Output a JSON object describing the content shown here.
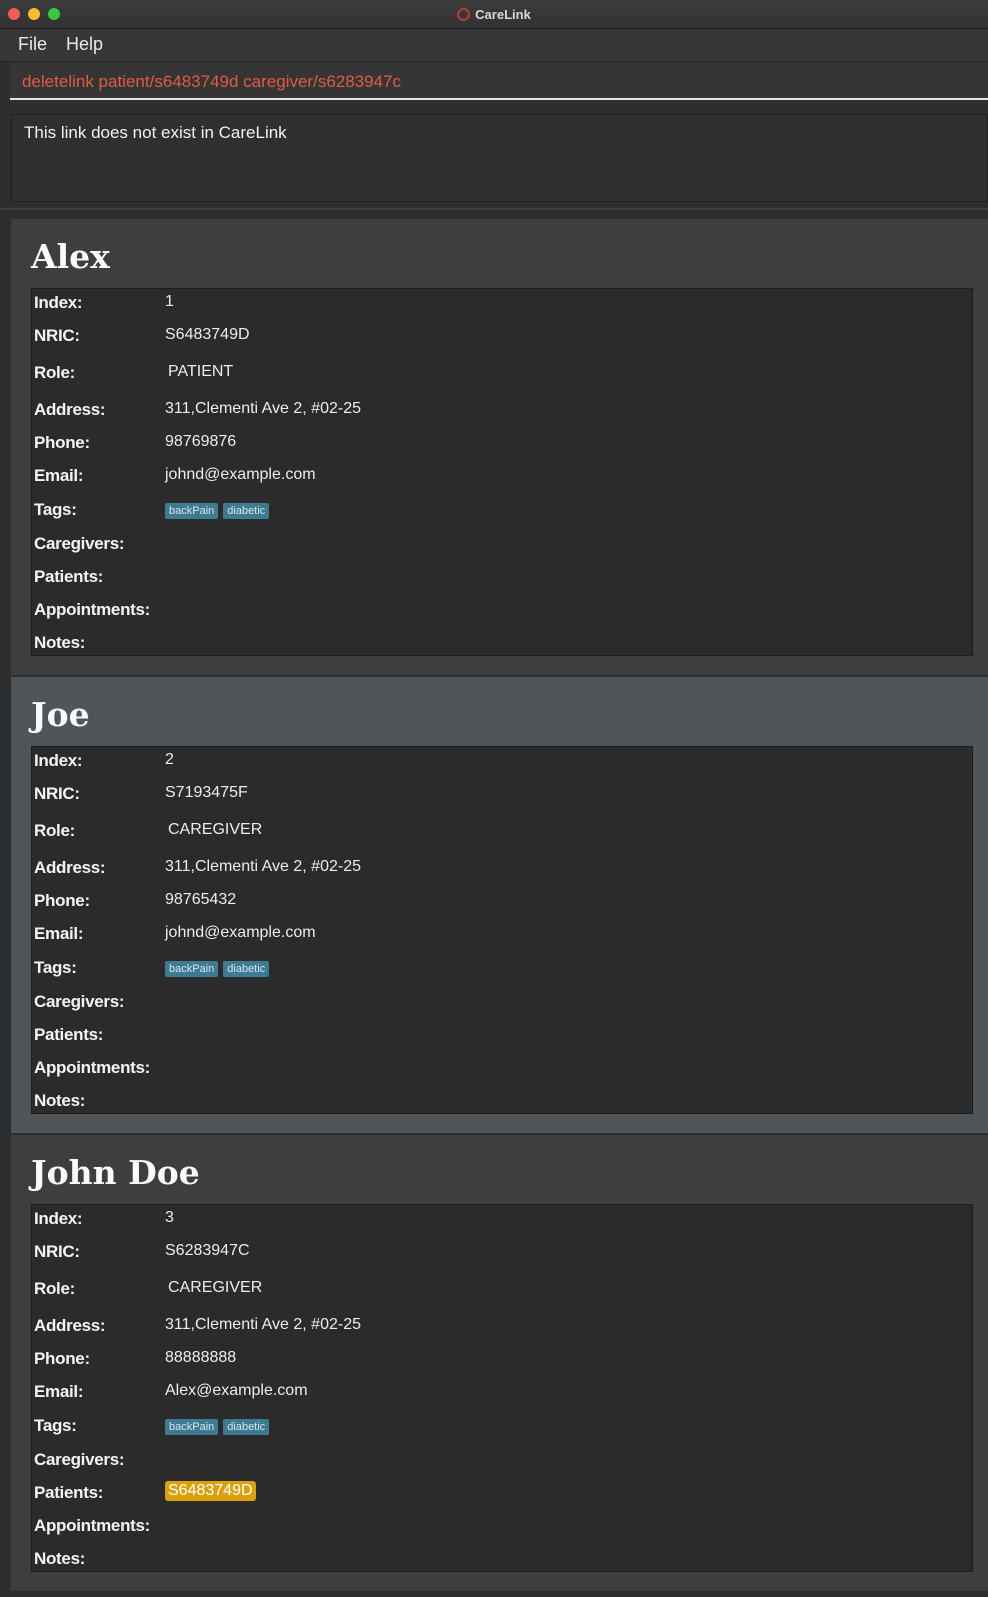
{
  "window": {
    "title": "CareLink"
  },
  "menu": {
    "file": "File",
    "help": "Help"
  },
  "command": {
    "value": "deletelink patient/s6483749d caregiver/s6283947c"
  },
  "result": {
    "message": "This link does not exist in CareLink"
  },
  "labels": {
    "index": "Index:",
    "nric": "NRIC:",
    "role": "Role:",
    "address": "Address:",
    "phone": "Phone:",
    "email": "Email:",
    "tags": "Tags:",
    "caregivers": "Caregivers:",
    "patients": "Patients:",
    "appointments": "Appointments:",
    "notes": "Notes:"
  },
  "persons": [
    {
      "name": "Alex",
      "index": "1",
      "nric": "S6483749D",
      "role": "PATIENT",
      "address": "311,Clementi Ave 2, #02-25",
      "phone": "98769876",
      "email": "johnd@example.com",
      "tags": [
        "backPain",
        "diabetic"
      ],
      "patients": [],
      "selected": false
    },
    {
      "name": "Joe",
      "index": "2",
      "nric": "S7193475F",
      "role": "CAREGIVER",
      "address": "311,Clementi Ave 2, #02-25",
      "phone": "98765432",
      "email": "johnd@example.com",
      "tags": [
        "backPain",
        "diabetic"
      ],
      "patients": [],
      "selected": true
    },
    {
      "name": "John Doe",
      "index": "3",
      "nric": "S6283947C",
      "role": "CAREGIVER",
      "address": "311,Clementi Ave 2, #02-25",
      "phone": "88888888",
      "email": "Alex@example.com",
      "tags": [
        "backPain",
        "diabetic"
      ],
      "patients": [
        "S6483749D"
      ],
      "selected": false
    }
  ],
  "colors": {
    "command_text": "#e35a42",
    "tag_bg": "#3e7b91",
    "patient_chip_bg": "#d9a20d",
    "selected_card_bg": "#4f5558"
  }
}
